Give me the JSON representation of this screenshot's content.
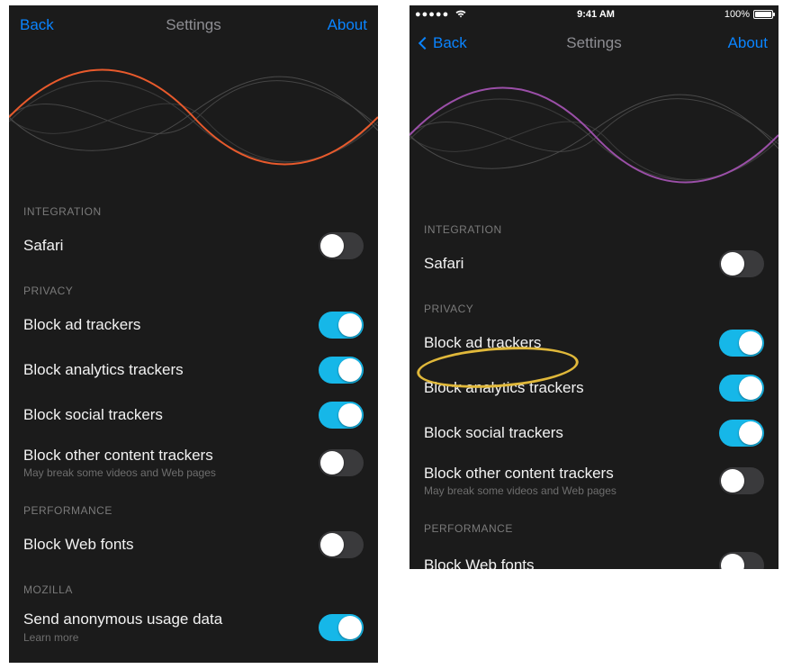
{
  "statusbar": {
    "signal": "●●●●●",
    "time": "9:41 AM",
    "battery": "100%"
  },
  "nav": {
    "back": "Back",
    "title": "Settings",
    "about": "About"
  },
  "sections": {
    "integration": {
      "header": "INTEGRATION",
      "safari": "Safari"
    },
    "privacy": {
      "header": "PRIVACY",
      "ad": "Block ad trackers",
      "analytics": "Block analytics trackers",
      "social": "Block social trackers",
      "other": "Block other content trackers",
      "other_sub": "May break some videos and Web pages"
    },
    "performance": {
      "header": "PERFORMANCE",
      "webfonts": "Block Web fonts"
    },
    "mozilla": {
      "header": "MOZILLA",
      "usage": "Send anonymous usage data",
      "usage_sub": "Learn more"
    }
  },
  "toggles": {
    "left": {
      "safari": false,
      "ad": true,
      "analytics": true,
      "social": true,
      "other": false,
      "webfonts": false,
      "usage": true
    },
    "right": {
      "safari": false,
      "ad": true,
      "analytics": true,
      "social": true,
      "other": false,
      "webfonts": false
    }
  },
  "wave_accent": {
    "left": "#e85a2c",
    "right": "#9b4fa8"
  }
}
